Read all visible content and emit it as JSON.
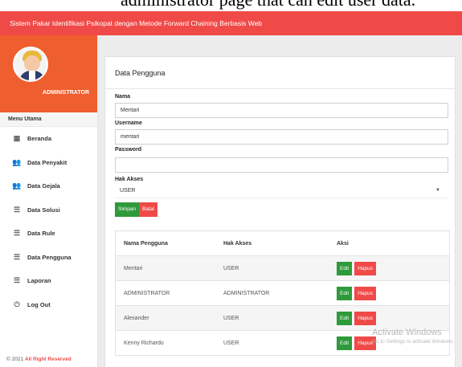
{
  "caption": "administrator page that can edit user data.",
  "topbar": {
    "title": "Sistem Pakar Identifikasi Psikopat dengan Metode Forward Chaining Berbasis Web"
  },
  "sidebar": {
    "role": "ADMINISTRATOR",
    "menu_header": "Menu Utama",
    "items": [
      {
        "label": "Beranda",
        "icon": "dashboard-icon",
        "glyph": "▦"
      },
      {
        "label": "Data Penyakit",
        "icon": "users-icon",
        "glyph": "👥"
      },
      {
        "label": "Data Gejala",
        "icon": "users-icon",
        "glyph": "👥"
      },
      {
        "label": "Data Solusi",
        "icon": "list-icon",
        "glyph": "☰"
      },
      {
        "label": "Data Rule",
        "icon": "list-icon",
        "glyph": "☰"
      },
      {
        "label": "Data Pengguna",
        "icon": "list-icon",
        "glyph": "☰"
      },
      {
        "label": "Laporan",
        "icon": "list-icon",
        "glyph": "☰"
      },
      {
        "label": "Log Out",
        "icon": "power-icon",
        "glyph": "⏻"
      }
    ],
    "footer_year": "© 2021",
    "footer_text": "All Right Reserved"
  },
  "card": {
    "title": "Data Pengguna",
    "form": {
      "nama_label": "Nama",
      "nama_value": "Mentari",
      "username_label": "Username",
      "username_value": "mentari",
      "password_label": "Password",
      "password_value": "",
      "hak_label": "Hak Akses",
      "hak_value": "USER",
      "save_label": "Simpan",
      "cancel_label": "Batal"
    },
    "table": {
      "headers": [
        "Nama Pengguna",
        "Hak Akses",
        "Aksi"
      ],
      "rows": [
        {
          "name": "Mentari",
          "role": "USER",
          "edit": "Edit",
          "delete": "Hapus"
        },
        {
          "name": "ADMINISTRATOR",
          "role": "ADMINISTRATOR",
          "edit": "Edit",
          "delete": "Hapus"
        },
        {
          "name": "Alexander",
          "role": "USER",
          "edit": "Edit",
          "delete": "Hapus"
        },
        {
          "name": "Kenny Richardo",
          "role": "USER",
          "edit": "Edit",
          "delete": "Hapus"
        }
      ]
    }
  },
  "watermark": {
    "line1": "Activate Windows",
    "line2": "Go to Settings to activate Windows."
  },
  "colors": {
    "topbar": "#f04a48",
    "profile": "#ef5e2e",
    "save": "#2e9a3b",
    "cancel": "#f04a48"
  }
}
